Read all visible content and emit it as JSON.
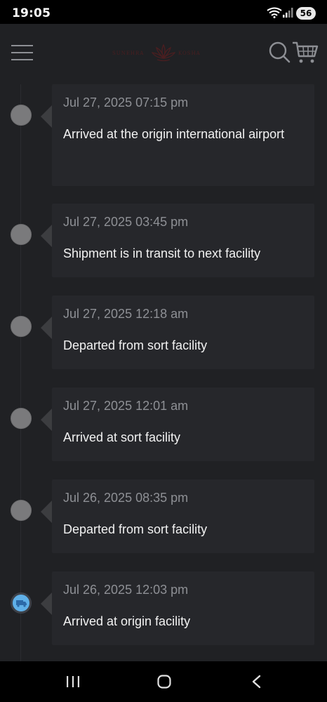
{
  "status_bar": {
    "time": "19:05",
    "battery": "56",
    "icons": [
      "wifi-icon",
      "signal-icon"
    ]
  },
  "header": {
    "logo_text_left": "SUNEHRA",
    "logo_text_right": "KOSHA",
    "icons": [
      "menu-icon",
      "lotus-logo",
      "search-icon",
      "cart-icon"
    ]
  },
  "timeline": [
    {
      "date": "Jul 27, 2025 07:15 pm",
      "description": "Arrived at the origin international airport",
      "icon": "dot",
      "active": false
    },
    {
      "date": "Jul 27, 2025 03:45 pm",
      "description": "Shipment is in transit to next facility",
      "icon": "dot",
      "active": false
    },
    {
      "date": "Jul 27, 2025 12:18 am",
      "description": "Departed from sort facility",
      "icon": "dot",
      "active": false
    },
    {
      "date": "Jul 27, 2025 12:01 am",
      "description": "Arrived at sort facility",
      "icon": "dot",
      "active": false
    },
    {
      "date": "Jul 26, 2025 08:35 pm",
      "description": "Departed from sort facility",
      "icon": "dot",
      "active": false
    },
    {
      "date": "Jul 26, 2025 12:03 pm",
      "description": "Arrived at origin facility",
      "icon": "truck-icon",
      "active": true
    }
  ],
  "colors": {
    "background": "#202124",
    "card": "#26272b",
    "date_text": "#8e9095",
    "desc_text": "#f2f2f2",
    "active_dot": "#5fb0e8",
    "inactive_dot": "#7a7a7c"
  },
  "nav_bar": {
    "icons": [
      "recents-icon",
      "home-icon",
      "back-icon"
    ]
  }
}
